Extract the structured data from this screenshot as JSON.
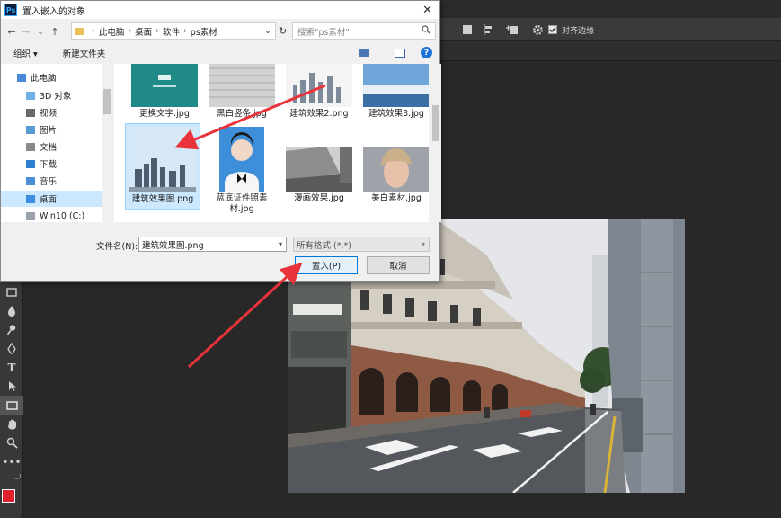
{
  "dialog": {
    "title": "置入嵌入的对象",
    "app_logo": "Ps",
    "close_glyph": "✕",
    "breadcrumb": [
      "此电脑",
      "桌面",
      "软件",
      "ps素材"
    ],
    "search_placeholder": "搜索\"ps素材\"",
    "toolbar": {
      "organize": "组织 ▾",
      "new_folder": "新建文件夹"
    },
    "nav_items": [
      {
        "label": "此电脑",
        "icon": "computer-icon"
      },
      {
        "label": "3D 对象",
        "icon": "cube-icon"
      },
      {
        "label": "视频",
        "icon": "video-folder-icon"
      },
      {
        "label": "图片",
        "icon": "pictures-folder-icon"
      },
      {
        "label": "文档",
        "icon": "documents-folder-icon"
      },
      {
        "label": "下载",
        "icon": "downloads-folder-icon"
      },
      {
        "label": "音乐",
        "icon": "music-folder-icon"
      },
      {
        "label": "桌面",
        "icon": "desktop-folder-icon",
        "selected": true
      },
      {
        "label": "Win10 (C:)",
        "icon": "drive-icon"
      }
    ],
    "files": [
      {
        "name": "更换文字.jpg"
      },
      {
        "name": "黑白竖条.jpg"
      },
      {
        "name": "建筑效果2.png"
      },
      {
        "name": "建筑效果3.jpg"
      },
      {
        "name": "建筑效果图.png",
        "selected": true
      },
      {
        "name": "蓝底证件照素材.jpg"
      },
      {
        "name": "漫画效果.jpg"
      },
      {
        "name": "美白素材.jpg"
      }
    ],
    "filename_label": "文件名(N):",
    "filename_value": "建筑效果图.png",
    "filetype_value": "所有格式 (*.*)",
    "place_button": "置入(P)",
    "cancel_button": "取消"
  },
  "options_bar": {
    "align_edges_label": "对齐边缘",
    "align_edges_checked": true
  },
  "colors": {
    "foreground": "#e0202a",
    "background": "#e0202a",
    "arrow": "#e8333a",
    "selection": "#cce8ff"
  }
}
